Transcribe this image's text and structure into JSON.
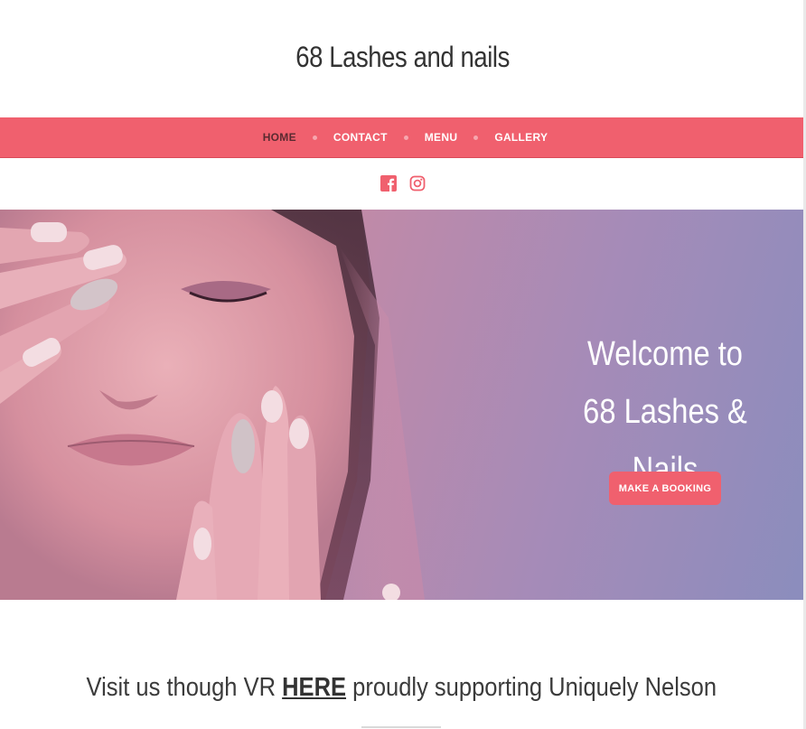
{
  "site": {
    "title": "68 Lashes and nails"
  },
  "nav": {
    "items": [
      {
        "label": "HOME"
      },
      {
        "label": "CONTACT"
      },
      {
        "label": "MENU"
      },
      {
        "label": "GALLERY"
      }
    ],
    "active": "HOME"
  },
  "social": {
    "icons": [
      "facebook-icon",
      "instagram-icon"
    ]
  },
  "hero": {
    "line1": "Welcome to",
    "line2": "68 Lashes & Nails",
    "cta_label": "MAKE A BOOKING"
  },
  "vr": {
    "prefix": "Visit us though VR ",
    "link": "HERE",
    "suffix": " proudly supporting Uniquely Nelson"
  },
  "colors": {
    "accent": "#f0606e",
    "title_text": "#333333",
    "hero_gradient_start": "#d58ea8",
    "hero_gradient_end": "#8b8dbd"
  }
}
